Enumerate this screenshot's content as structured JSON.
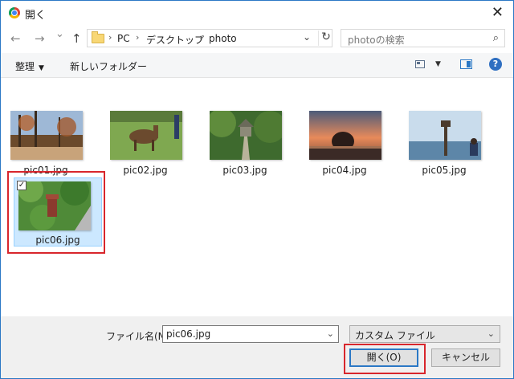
{
  "window": {
    "title": "開く",
    "close_glyph": "✕"
  },
  "nav": {
    "back": "←",
    "forward": "→",
    "recent": "⌄",
    "up": "↑",
    "breadcrumbs": [
      "PC",
      "デスクトップ",
      "photo"
    ],
    "separator": "›",
    "refresh": "↻",
    "search_placeholder": "photoの検索",
    "search_icon": "⌕"
  },
  "toolbar": {
    "organize_label": "整理",
    "new_folder_label": "新しいフォルダー",
    "help_label": "?"
  },
  "files": [
    {
      "name": "pic01.jpg",
      "selected": false
    },
    {
      "name": "pic02.jpg",
      "selected": false
    },
    {
      "name": "pic03.jpg",
      "selected": false
    },
    {
      "name": "pic04.jpg",
      "selected": false
    },
    {
      "name": "pic05.jpg",
      "selected": false
    },
    {
      "name": "pic06.jpg",
      "selected": true
    }
  ],
  "bottom": {
    "filename_label": "ファイル名(N):",
    "filename_value": "pic06.jpg",
    "filetype_value": "カスタム ファイル",
    "open_button": "開く(O)",
    "cancel_button": "キャンセル"
  },
  "colors": {
    "accent": "#2b78c5",
    "highlight_red": "#d8262c",
    "selection": "#cce8ff"
  }
}
